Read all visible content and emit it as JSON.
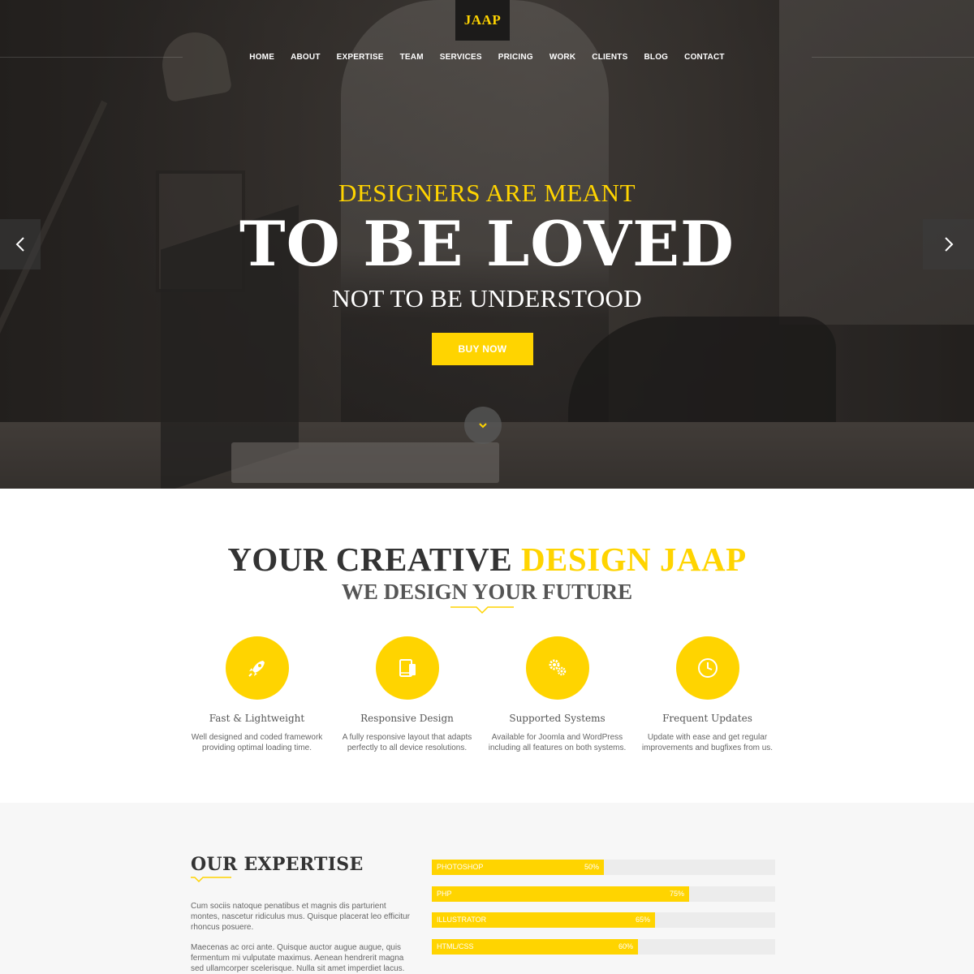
{
  "brand": {
    "logo": "JAAP",
    "accent": "#ffd400"
  },
  "nav": {
    "items": [
      "HOME",
      "ABOUT",
      "EXPERTISE",
      "TEAM",
      "SERVICES",
      "PRICING",
      "WORK",
      "CLIENTS",
      "BLOG",
      "CONTACT"
    ],
    "active": "HOME"
  },
  "hero": {
    "kicker": "DESIGNERS ARE MEANT",
    "headline": "TO BE LOVED",
    "subline": "NOT TO BE UNDERSTOOD",
    "cta": "BUY NOW",
    "prev_icon": "chevron-left-icon",
    "next_icon": "chevron-right-icon",
    "scroll_icon": "chevron-down-icon"
  },
  "intro": {
    "title_plain": "YOUR CREATIVE ",
    "title_highlight": "DESIGN JAAP",
    "subtitle": "WE DESIGN YOUR FUTURE"
  },
  "features": [
    {
      "icon": "rocket-icon",
      "title": "Fast & Lightweight",
      "desc": "Well designed and coded framework providing optimal loading time."
    },
    {
      "icon": "devices-icon",
      "title": "Responsive Design",
      "desc": "A fully responsive layout that adapts perfectly to all device resolutions."
    },
    {
      "icon": "gears-icon",
      "title": "Supported Systems",
      "desc": "Available for Joomla and WordPress including all features on both systems."
    },
    {
      "icon": "clock-icon",
      "title": "Frequent Updates",
      "desc": "Update with ease and get regular improvements and bugfixes from us."
    }
  ],
  "expertise": {
    "title": "OUR EXPERTISE",
    "p1": "Cum sociis natoque penatibus et magnis dis parturient montes, nascetur ridiculus mus. Quisque placerat leo efficitur rhoncus posuere.",
    "p2": "Maecenas ac orci ante. Quisque auctor augue augue, quis fermentum mi vulputate maximus. Aenean hendrerit magna sed ullamcorper scelerisque. Nulla sit amet imperdiet lacus. Nunc.",
    "skills": [
      {
        "name": "PHOTOSHOP",
        "label": "50%",
        "value": 0.5
      },
      {
        "name": "PHP",
        "label": "75%",
        "value": 0.75
      },
      {
        "name": "ILLUSTRATOR",
        "label": "65%",
        "value": 0.65
      },
      {
        "name": "HTML/CSS",
        "label": "60%",
        "value": 0.6
      }
    ]
  }
}
